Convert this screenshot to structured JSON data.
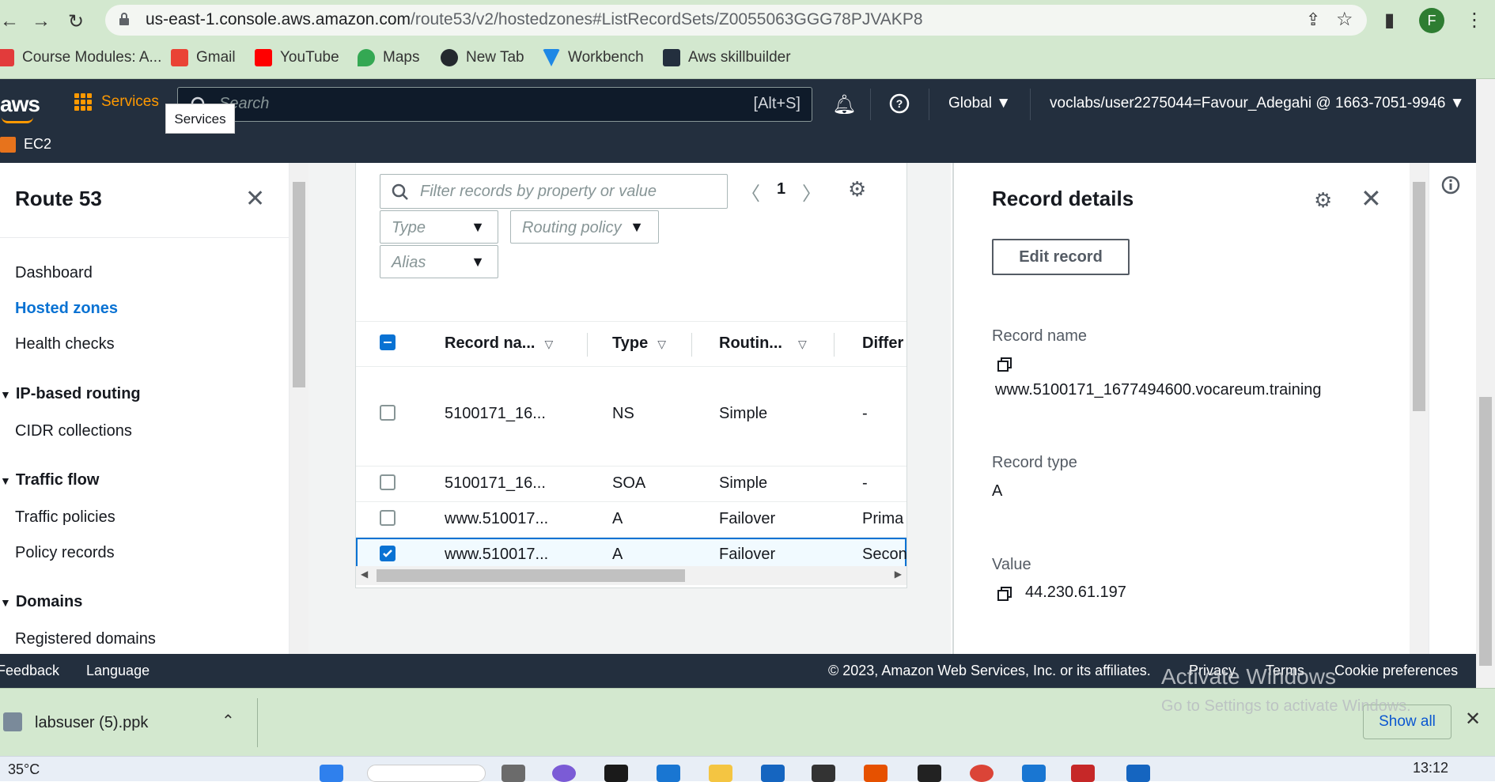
{
  "browser": {
    "url_host": "us-east-1.console.aws.amazon.com",
    "url_path": "/route53/v2/hostedzones#ListRecordSets/Z0055063GGG78PJVAKP8",
    "profile_initial": "F"
  },
  "bookmarks": [
    {
      "label": "Course Modules: A...",
      "icon": "canvas-icon",
      "color": "#e23b3b"
    },
    {
      "label": "Gmail",
      "icon": "gmail-icon",
      "color": "#ea4335"
    },
    {
      "label": "YouTube",
      "icon": "youtube-icon",
      "color": "#ff0000"
    },
    {
      "label": "Maps",
      "icon": "maps-icon",
      "color": "#34a853"
    },
    {
      "label": "New Tab",
      "icon": "github-icon",
      "color": "#24292e"
    },
    {
      "label": "Workbench",
      "icon": "vocareum-icon",
      "color": "#1e88e5"
    },
    {
      "label": "Aws skillbuilder",
      "icon": "aws-icon",
      "color": "#232f3e"
    }
  ],
  "aws_header": {
    "logo": "aws",
    "services_label": "Services",
    "services_tooltip": "Services",
    "search_placeholder": "Search",
    "search_shortcut": "[Alt+S]",
    "region": "Global ▼",
    "account": "voclabs/user2275044=Favour_Adegahi @ 1663-7051-9946 ▼",
    "favorite_service": "EC2",
    "accent_color": "#ff9900"
  },
  "sidebar": {
    "title": "Route 53",
    "items": [
      {
        "label": "Dashboard",
        "active": false
      },
      {
        "label": "Hosted zones",
        "active": true
      },
      {
        "label": "Health checks",
        "active": false
      }
    ],
    "sections": [
      {
        "label": "IP-based routing",
        "items": [
          "CIDR collections"
        ]
      },
      {
        "label": "Traffic flow",
        "items": [
          "Traffic policies",
          "Policy records"
        ]
      },
      {
        "label": "Domains",
        "items": [
          "Registered domains"
        ]
      }
    ]
  },
  "records_table": {
    "filter_placeholder": "Filter records by property or value",
    "type_placeholder": "Type",
    "routing_policy_placeholder": "Routing policy",
    "alias_placeholder": "Alias",
    "page": "1",
    "columns": [
      "Record na...",
      "Type",
      "Routin...",
      "Differ"
    ],
    "rows": [
      {
        "name": "5100171_16...",
        "type": "NS",
        "routing": "Simple",
        "differ": "-",
        "selected": false
      },
      {
        "name": "5100171_16...",
        "type": "SOA",
        "routing": "Simple",
        "differ": "-",
        "selected": false
      },
      {
        "name": "www.510017...",
        "type": "A",
        "routing": "Failover",
        "differ": "Prima",
        "selected": false
      },
      {
        "name": "www.510017...",
        "type": "A",
        "routing": "Failover",
        "differ": "Secon",
        "selected": true
      }
    ]
  },
  "record_details": {
    "title": "Record details",
    "edit_button": "Edit record",
    "record_name_label": "Record name",
    "record_name_value": "www.5100171_1677494600.vocareum.training",
    "record_type_label": "Record type",
    "record_type_value": "A",
    "value_label": "Value",
    "value_value": "44.230.61.197"
  },
  "footer": {
    "feedback": "Feedback",
    "language": "Language",
    "copyright": "© 2023, Amazon Web Services, Inc. or its affiliates.",
    "privacy": "Privacy",
    "terms": "Terms",
    "cookies": "Cookie preferences"
  },
  "downloads": {
    "file": "labsuser (5).ppk",
    "show_all": "Show all"
  },
  "watermark": {
    "line1": "Activate Windows",
    "line2": "Go to Settings to activate Windows."
  },
  "taskbar": {
    "weather": "35°C",
    "clock": "13:12"
  }
}
